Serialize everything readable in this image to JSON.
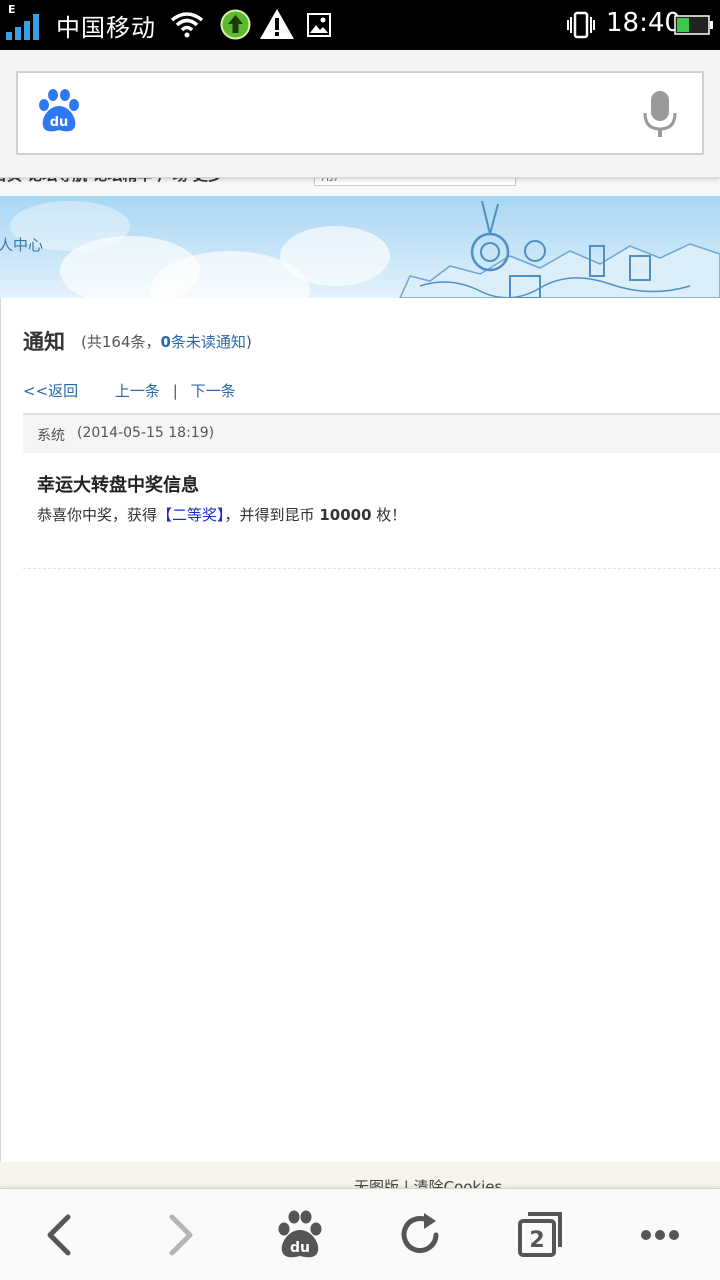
{
  "status_bar": {
    "network_type": "E",
    "carrier": "中国移动",
    "time": "18:40"
  },
  "search": {
    "logo_text": "du"
  },
  "page_nav": {
    "text": "首页  论坛导航  论坛精华  广场  更多",
    "search_hint": "用户"
  },
  "banner": {
    "user_center": "人中心"
  },
  "notice": {
    "title": "通知",
    "count_prefix": "(共164条，",
    "unread_count": "0",
    "unread_suffix": "条未读通知",
    "count_close": ")"
  },
  "nav_links": {
    "back": "<<返回",
    "prev": "上一条",
    "separator": "|",
    "next": "下一条"
  },
  "message": {
    "sender": "系统",
    "time": "(2014-05-15 18:19)",
    "title": "幸运大转盘中奖信息",
    "body_prefix": "恭喜你中奖，获得",
    "prize": "【二等奖】",
    "body_middle": "，并得到昆币",
    "coins": "10000",
    "body_suffix": "枚！"
  },
  "footer": {
    "text": "无图版  |  清除Cookies"
  },
  "bottom_bar": {
    "tab_count": "2"
  },
  "colors": {
    "link": "#2b6aa8",
    "prize": "#1a2fc4",
    "baidu_blue": "#2d78f4",
    "upload_green": "#5fb92d"
  }
}
